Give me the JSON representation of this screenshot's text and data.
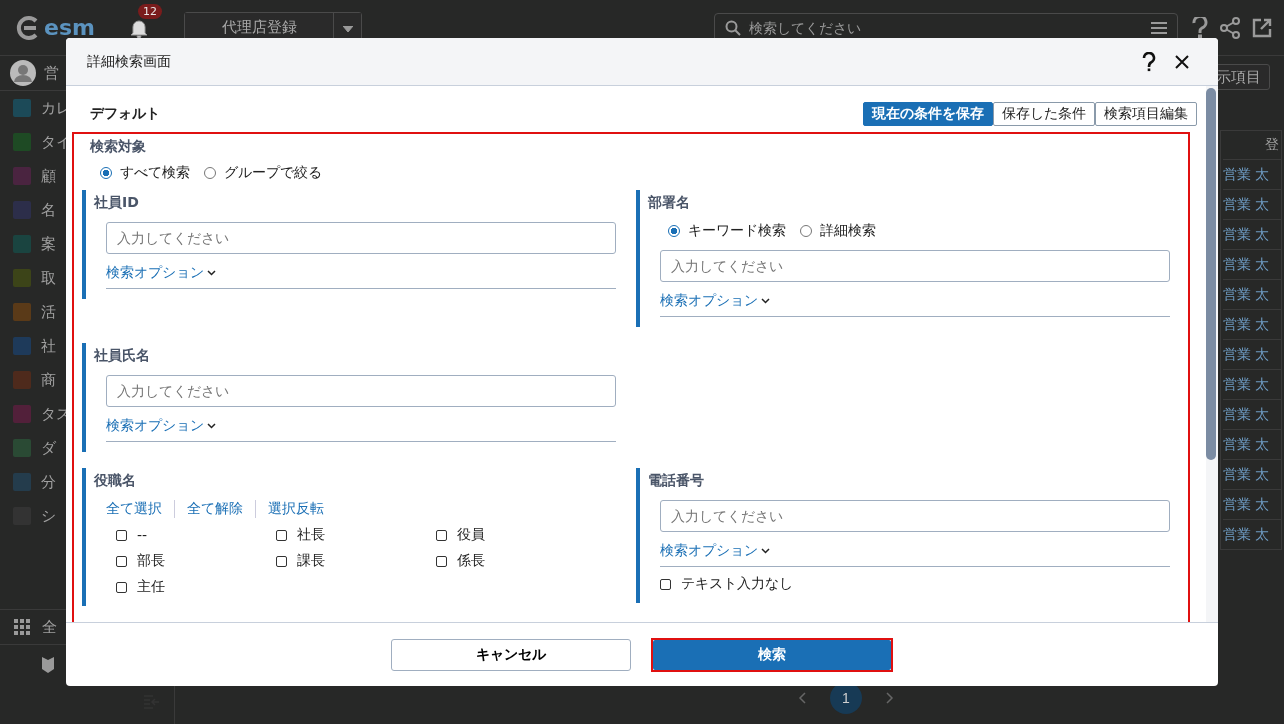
{
  "background": {
    "logo": "esm",
    "notification_count": "12",
    "registration_button": "代理店登録",
    "search": {
      "placeholder": "検索してください"
    },
    "user_name": "営",
    "sidebar": {
      "items": [
        {
          "label": "カレ",
          "color": "#1c4a58"
        },
        {
          "label": "タイ",
          "color": "#1e4a24"
        },
        {
          "label": "顧",
          "color": "#4a2440"
        },
        {
          "label": "名",
          "color": "#2c2e4a"
        },
        {
          "label": "案",
          "color": "#1a4440"
        },
        {
          "label": "取",
          "color": "#3c4418"
        },
        {
          "label": "活",
          "color": "#5a3a18"
        },
        {
          "label": "社",
          "color": "#1e3a5a"
        },
        {
          "label": "商",
          "color": "#4e2a1c"
        },
        {
          "label": "タス",
          "color": "#52203a"
        },
        {
          "label": "ダ",
          "color": "#2a4a34"
        },
        {
          "label": "分",
          "color": "#243c4c"
        },
        {
          "label": "シ",
          "color": "#333333"
        }
      ],
      "all_menu": "全"
    },
    "display_items_button": "示項目",
    "table": {
      "column_header": "登",
      "rows": [
        {
          "column_1": "営業",
          "column_2": "太"
        },
        {
          "column_1": "営業",
          "column_2": "太"
        },
        {
          "column_1": "営業",
          "column_2": "太"
        },
        {
          "column_1": "営業",
          "column_2": "太"
        },
        {
          "column_1": "営業",
          "column_2": "太"
        },
        {
          "column_1": "営業",
          "column_2": "太"
        },
        {
          "column_1": "営業",
          "column_2": "太"
        },
        {
          "column_1": "営業",
          "column_2": "太"
        },
        {
          "column_1": "営業",
          "column_2": "太"
        },
        {
          "column_1": "営業",
          "column_2": "太"
        },
        {
          "column_1": "営業",
          "column_2": "太"
        },
        {
          "column_1": "営業",
          "column_2": "太"
        },
        {
          "column_1": "営業",
          "column_2": "太"
        }
      ]
    },
    "pagination": {
      "page": "1"
    }
  },
  "dialog": {
    "title": "詳細検索画面",
    "preset_name": "デフォルト",
    "actions": [
      {
        "label": "現在の条件を保存",
        "primary": true
      },
      {
        "label": "保存した条件",
        "primary": false
      },
      {
        "label": "検索項目編集",
        "primary": false
      }
    ],
    "search_target": {
      "label": "検索対象",
      "options": [
        {
          "label": "すべて検索",
          "selected": true
        },
        {
          "label": "グループで絞る",
          "selected": false
        }
      ]
    },
    "fields": [
      {
        "kind": "text",
        "label": "社員ID",
        "placeholder": "入力してください",
        "option_link": "検索オプション"
      },
      {
        "kind": "text",
        "label": "部署名",
        "modes": [
          {
            "label": "キーワード検索",
            "selected": true
          },
          {
            "label": "詳細検索",
            "selected": false
          }
        ],
        "placeholder": "入力してください",
        "option_link": "検索オプション"
      },
      {
        "kind": "text",
        "label": "社員氏名",
        "placeholder": "入力してください",
        "option_link": "検索オプション"
      },
      {
        "kind": "spacer"
      },
      {
        "kind": "checkbox_group",
        "label": "役職名",
        "links": [
          "全て選択",
          "全て解除",
          "選択反転"
        ],
        "options": [
          {
            "label": "--",
            "checked": false
          },
          {
            "label": "社長",
            "checked": false
          },
          {
            "label": "役員",
            "checked": false
          },
          {
            "label": "部長",
            "checked": false
          },
          {
            "label": "課長",
            "checked": false
          },
          {
            "label": "係長",
            "checked": false
          },
          {
            "label": "主任",
            "checked": false
          }
        ]
      },
      {
        "kind": "text",
        "label": "電話番号",
        "placeholder": "入力してください",
        "option_link": "検索オプション",
        "no_text_option": {
          "label": "テキスト入力なし",
          "checked": false
        }
      }
    ],
    "cancel_button": "キャンセル",
    "search_button": "検索"
  }
}
